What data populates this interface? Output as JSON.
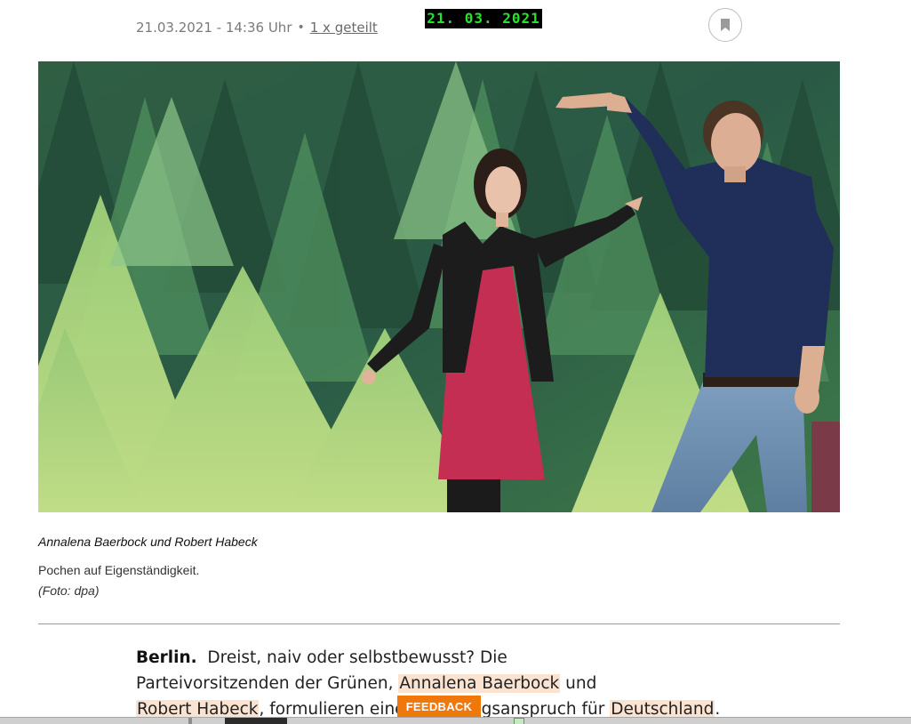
{
  "meta": {
    "date": "21.03.2021 - 14:36 Uhr",
    "separator": "•",
    "shared": "1 x geteilt"
  },
  "stamp": "21. 03. 2021",
  "bookmark": {
    "icon": "bookmark-icon"
  },
  "photo": {
    "subjects": [
      "Annalena Baerbock",
      "Robert Habeck"
    ]
  },
  "caption": {
    "title": "Annalena Baerbock und Robert Habeck",
    "text": "Pochen auf Eigenständigkeit.",
    "credit": "(Foto: dpa)"
  },
  "article": {
    "dateline": "Berlin.",
    "line1_rest": "Dreist, naiv oder selbstbewusst? Die",
    "line2_a": "Parteivorsitzenden der Grünen, ",
    "line2_hl": "Annalena Baerbock",
    "line2_b": " und",
    "line3_hl1": "Robert Habeck",
    "line3_a": ", formulieren eine",
    "line3_b": "gsanspruch für ",
    "line3_hl2": "Deutschland",
    "line3_c": "."
  },
  "feedback": {
    "label": "FEEDBACK"
  },
  "colors": {
    "accent": "#f0780a",
    "highlight": "#fbe3d2",
    "stamp_text": "#27e327"
  }
}
